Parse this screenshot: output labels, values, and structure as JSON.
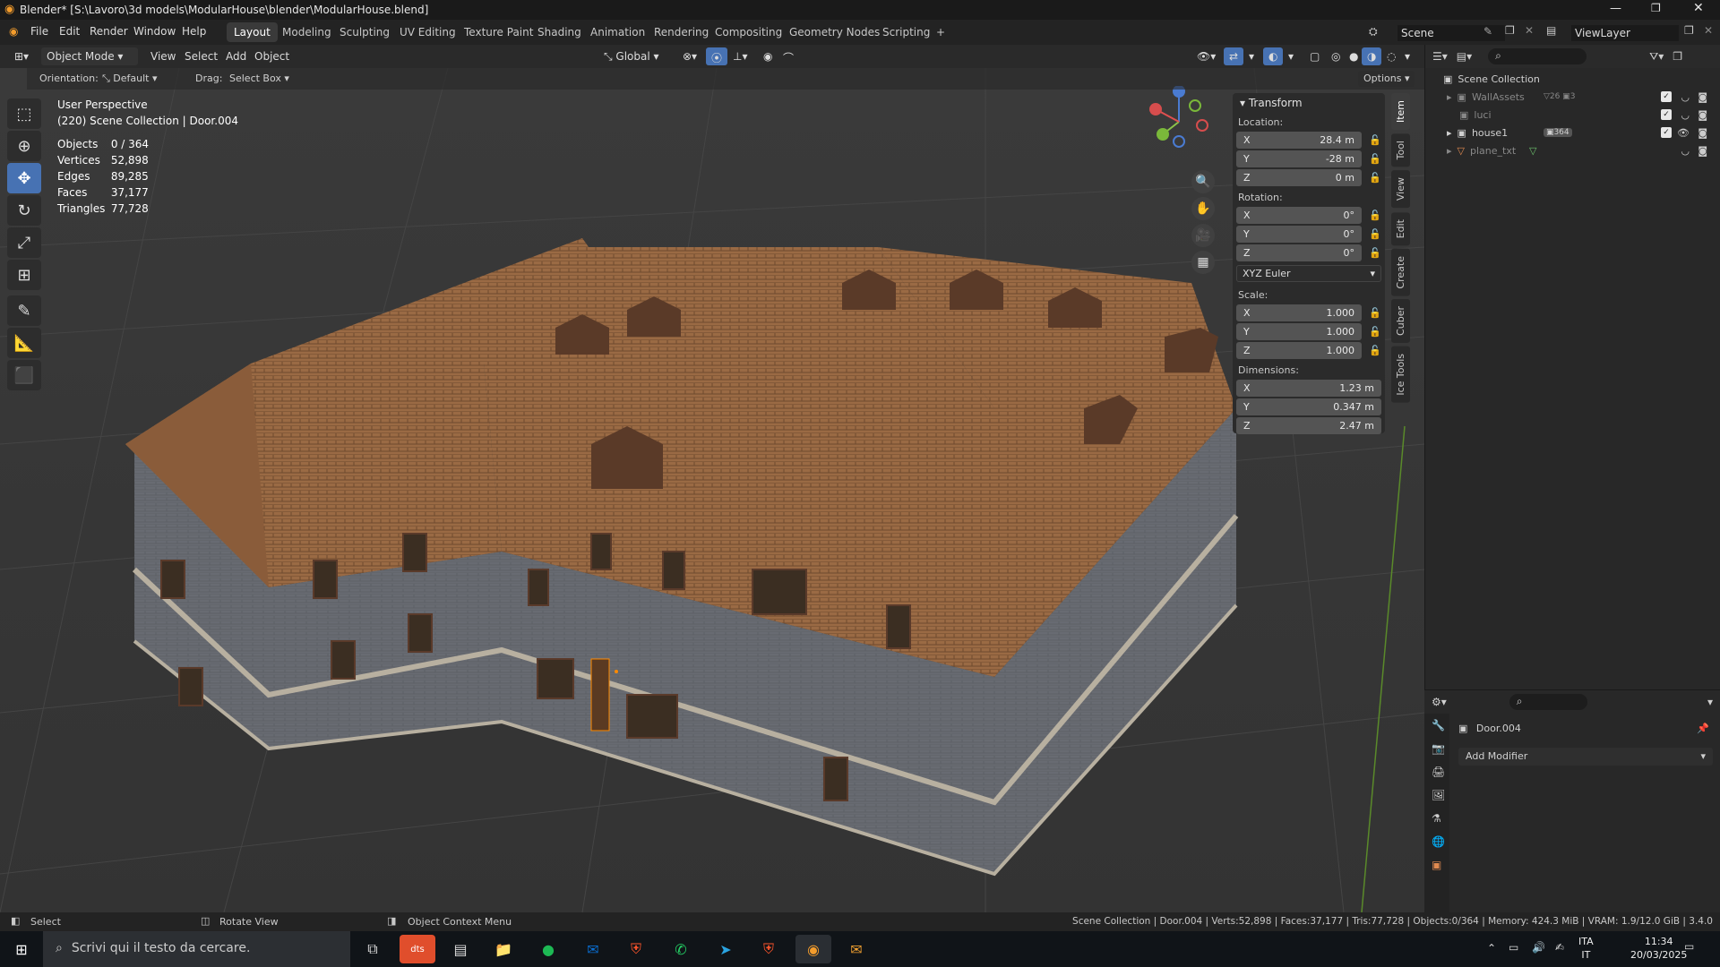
{
  "window": {
    "title": "Blender* [S:\\Lavoro\\3d models\\ModularHouse\\blender\\ModularHouse.blend]"
  },
  "menu": [
    "File",
    "Edit",
    "Render",
    "Window",
    "Help"
  ],
  "workspaces": [
    "Layout",
    "Modeling",
    "Sculpting",
    "UV Editing",
    "Texture Paint",
    "Shading",
    "Animation",
    "Rendering",
    "Compositing",
    "Geometry Nodes",
    "Scripting"
  ],
  "scene": {
    "label": "Scene",
    "view_layer": "ViewLayer"
  },
  "viewport_header": {
    "mode": "Object Mode",
    "view": "View",
    "select": "Select",
    "add": "Add",
    "object": "Object",
    "orientation_space": "Global",
    "options": "Options"
  },
  "tool_settings": {
    "orientation_label": "Orientation:",
    "orientation_value": "Default",
    "drag_label": "Drag:",
    "drag_value": "Select Box"
  },
  "overlay_info": {
    "perspective": "User Perspective",
    "collection": "(220) Scene Collection | Door.004"
  },
  "stats": [
    {
      "label": "Objects",
      "value": "0 / 364"
    },
    {
      "label": "Vertices",
      "value": "52,898"
    },
    {
      "label": "Edges",
      "value": "89,285"
    },
    {
      "label": "Faces",
      "value": "37,177"
    },
    {
      "label": "Triangles",
      "value": "77,728"
    }
  ],
  "transform": {
    "title": "Transform",
    "location_label": "Location:",
    "location": [
      {
        "axis": "X",
        "value": "28.4 m"
      },
      {
        "axis": "Y",
        "value": "-28 m"
      },
      {
        "axis": "Z",
        "value": "0 m"
      }
    ],
    "rotation_label": "Rotation:",
    "rotation": [
      {
        "axis": "X",
        "value": "0°"
      },
      {
        "axis": "Y",
        "value": "0°"
      },
      {
        "axis": "Z",
        "value": "0°"
      }
    ],
    "rotation_mode": "XYZ Euler",
    "scale_label": "Scale:",
    "scale": [
      {
        "axis": "X",
        "value": "1.000"
      },
      {
        "axis": "Y",
        "value": "1.000"
      },
      {
        "axis": "Z",
        "value": "1.000"
      }
    ],
    "dimensions_label": "Dimensions:",
    "dimensions": [
      {
        "axis": "X",
        "value": "1.23 m"
      },
      {
        "axis": "Y",
        "value": "0.347 m"
      },
      {
        "axis": "Z",
        "value": "2.47 m"
      }
    ]
  },
  "sidebar_tabs": [
    "Item",
    "Tool",
    "View",
    "Edit",
    "Create",
    "Cuber",
    "Ice Tools"
  ],
  "outliner": {
    "root": "Scene Collection",
    "items": [
      {
        "name": "WallAssets",
        "badge1": "26",
        "badge2": "3"
      },
      {
        "name": "luci"
      },
      {
        "name": "house1",
        "badge1": "364"
      },
      {
        "name": "plane_txt"
      }
    ]
  },
  "properties": {
    "object_name": "Door.004",
    "add_modifier": "Add Modifier"
  },
  "statusbar": {
    "select": "Select",
    "rotate": "Rotate View",
    "context": "Object Context Menu",
    "info": "Scene Collection | Door.004 | Verts:52,898 | Faces:37,177 | Tris:77,728 | Objects:0/364 | Memory: 424.3 MiB | VRAM: 1.9/12.0 GiB | 3.4.0"
  },
  "taskbar": {
    "search_placeholder": "Scrivi qui il testo da cercare.",
    "lang1": "ITA",
    "lang2": "IT",
    "time": "11:34",
    "date": "20/03/2025"
  },
  "colors": {
    "accent": "#4772b3",
    "roof": "#9a6a44",
    "wall": "#6b6e75",
    "trim": "#b8b0a0"
  }
}
